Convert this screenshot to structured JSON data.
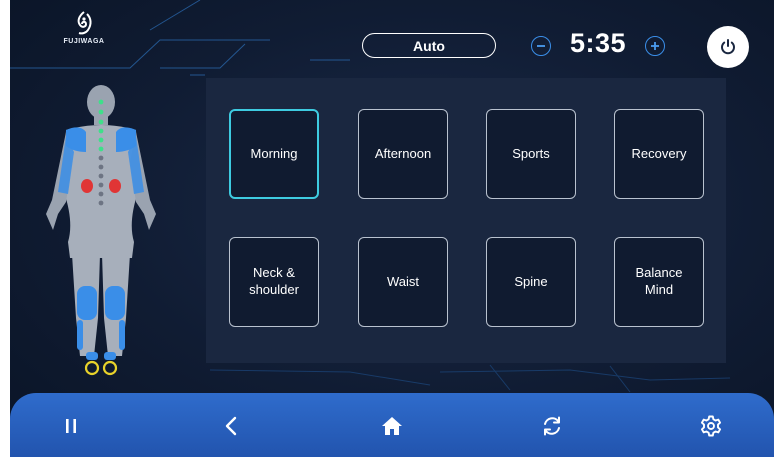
{
  "brand": {
    "name": "FUJIWAGA"
  },
  "header": {
    "mode_label": "Auto",
    "timer_minus_icon": "minus-circle-icon",
    "timer_value": "5:35",
    "timer_plus_icon": "plus-circle-icon",
    "power_icon": "power-icon"
  },
  "programs": [
    {
      "label": "Morning",
      "active": true
    },
    {
      "label": "Afternoon",
      "active": false
    },
    {
      "label": "Sports",
      "active": false
    },
    {
      "label": "Recovery",
      "active": false
    },
    {
      "label": "Neck &\nshoulder",
      "active": false
    },
    {
      "label": "Waist",
      "active": false
    },
    {
      "label": "Spine",
      "active": false
    },
    {
      "label": "Balance\nMind",
      "active": false
    }
  ],
  "nav": [
    {
      "icon": "pause-icon"
    },
    {
      "icon": "back-icon"
    },
    {
      "icon": "home-icon"
    },
    {
      "icon": "rotate-icon"
    },
    {
      "icon": "settings-icon"
    }
  ],
  "colors": {
    "background": "#101c33",
    "panel": "#1a2740",
    "accent_active": "#3ecbe0",
    "timer_buttons": "#3a8ee8",
    "navbar": "#2a62c0",
    "massage_zone": "#3a8ee8",
    "heat_zone": "#e03535",
    "spine_point_active": "#3ee08a",
    "foot_ring": "#e8d22a"
  }
}
